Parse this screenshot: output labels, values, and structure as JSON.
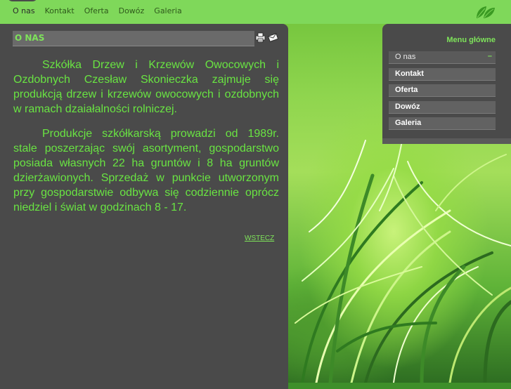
{
  "nav": {
    "items": [
      {
        "label": "O nas"
      },
      {
        "label": "Kontakt"
      },
      {
        "label": "Oferta"
      },
      {
        "label": "Dowóz"
      },
      {
        "label": "Galeria"
      }
    ]
  },
  "main": {
    "header": "O NAS",
    "paragraphs": [
      "Szkółka Drzew i Krzewów Owocowych i Ozdobnych Czesław Skonieczka zajmuje się produkcją drzew i krzewów owocowych i ozdobnych w ramach dzaiałalności rolniczej.",
      "Produkcje szkółkarską prowadzi od 1989r. stale poszerzając swój asortyment, gospodarstwo posiada własnych 22 ha gruntów i 8 ha gruntów dzierżawionych. Sprzedaż w punkcie  utworzonym przy gospodarstwie odbywa się codziennie oprócz niedziel i świat w godzinach  8 - 17."
    ],
    "back_link": "WSTECZ",
    "icons": [
      "print-icon",
      "email-icon"
    ]
  },
  "menu": {
    "title": "Menu główne",
    "items": [
      {
        "label": "O nas",
        "marker": "–"
      },
      {
        "label": "Kontakt"
      },
      {
        "label": "Oferta"
      },
      {
        "label": "Dowóz"
      },
      {
        "label": "Galeria"
      }
    ]
  },
  "colors": {
    "accent_green": "#69e442",
    "panel_gray": "#4a4a4a",
    "nav_green": "#7fd85a"
  }
}
